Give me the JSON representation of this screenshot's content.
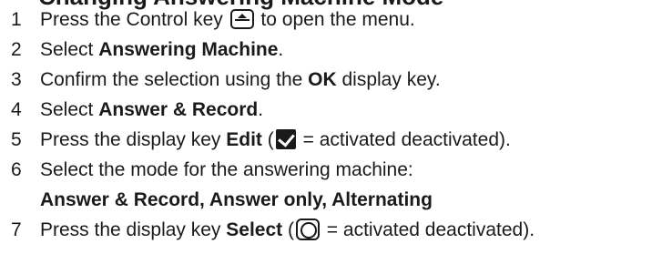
{
  "heading_fragment": "Changing Answering Machine Mode",
  "icons": {
    "control_key": "control-key-icon",
    "checkbox": "checkbox-checked-icon",
    "radio": "radio-button-icon"
  },
  "steps": [
    {
      "num": "1",
      "pre": "Press the Control key ",
      "post": " to open the menu."
    },
    {
      "num": "2",
      "pre": "Select ",
      "bold": "Answering Machine",
      "post": "."
    },
    {
      "num": "3",
      "pre": "Confirm the selection using the ",
      "bold": "OK",
      "post": " display key."
    },
    {
      "num": "4",
      "pre": "Select ",
      "bold": "Answer & Record",
      "post": "."
    },
    {
      "num": "5",
      "pre": "Press the display key ",
      "bold": "Edit",
      "paren_open": " (",
      "post": " = activated deactivated)."
    },
    {
      "num": "6",
      "pre": "Select the mode for the answering machine:",
      "options": "Answer & Record, Answer only, Alternating"
    },
    {
      "num": "7",
      "pre": "Press the display key ",
      "bold": "Select",
      "paren_open": " (",
      "post": " = activated deactivated)."
    }
  ]
}
